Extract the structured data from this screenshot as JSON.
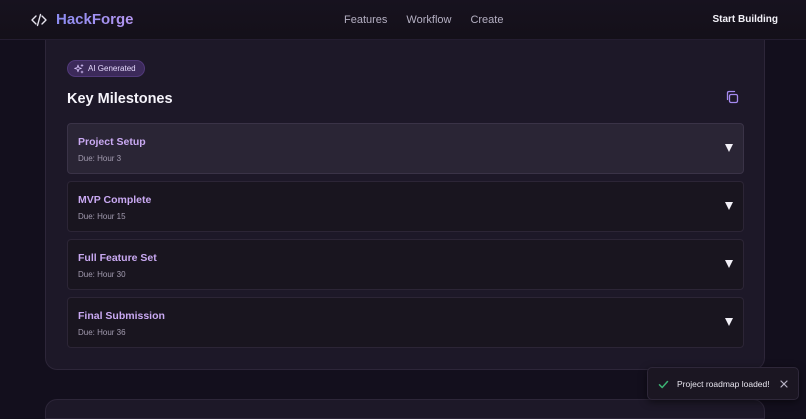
{
  "header": {
    "brand": "HackForge",
    "nav": [
      "Features",
      "Workflow",
      "Create"
    ],
    "cta": "Start Building"
  },
  "card": {
    "badge": "AI Generated",
    "title": "Key Milestones",
    "milestones": [
      {
        "title": "Project Setup",
        "due": "Due: Hour 3"
      },
      {
        "title": "MVP Complete",
        "due": "Due: Hour 15"
      },
      {
        "title": "Full Feature Set",
        "due": "Due: Hour 30"
      },
      {
        "title": "Final Submission",
        "due": "Due: Hour 36"
      }
    ]
  },
  "toast": {
    "message": "Project roadmap loaded!"
  },
  "colors": {
    "accent": "#a58af0",
    "milestone_title": "#c9a9f2",
    "success": "#3bb273",
    "background": "#130f1d"
  },
  "icons": {
    "brand": "code-icon",
    "badge": "sparkles-icon",
    "copy": "copy-icon",
    "milestone": "chevron-down-icon",
    "toast_status": "check-icon",
    "toast_close": "close-icon"
  }
}
